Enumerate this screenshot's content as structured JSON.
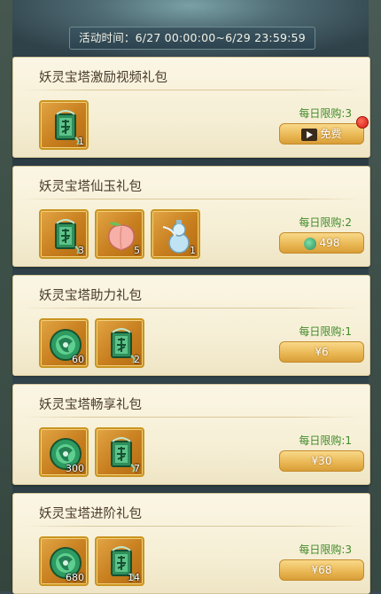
{
  "header": {
    "time_text": "活动时间：6/27 00:00:00~6/29 23:59:59"
  },
  "packs": [
    {
      "title": "妖灵宝塔激励视频礼包",
      "limit": "每日限购:3",
      "price": "免费",
      "price_icon": "video-icon",
      "has_red_dot": true,
      "items": [
        {
          "icon": "jade-token-icon",
          "count": "1"
        }
      ]
    },
    {
      "title": "妖灵宝塔仙玉礼包",
      "limit": "每日限购:2",
      "price": "498",
      "price_icon": "jade-coin-icon",
      "items": [
        {
          "icon": "jade-token-icon",
          "count": "3"
        },
        {
          "icon": "peach-icon",
          "count": "5"
        },
        {
          "icon": "gourd-icon",
          "count": "1"
        }
      ]
    },
    {
      "title": "妖灵宝塔助力礼包",
      "limit": "每日限购:1",
      "price": "¥6",
      "items": [
        {
          "icon": "jade-disc-icon",
          "count": "60"
        },
        {
          "icon": "jade-token-icon",
          "count": "2"
        }
      ]
    },
    {
      "title": "妖灵宝塔畅享礼包",
      "limit": "每日限购:1",
      "price": "¥30",
      "items": [
        {
          "icon": "jade-disc-icon",
          "count": "300"
        },
        {
          "icon": "jade-token-icon",
          "count": "7"
        }
      ]
    },
    {
      "title": "妖灵宝塔进阶礼包",
      "limit": "每日限购:3",
      "price": "¥68",
      "items": [
        {
          "icon": "jade-disc-icon",
          "count": "680"
        },
        {
          "icon": "jade-token-icon",
          "count": "14"
        }
      ]
    }
  ],
  "colors": {
    "limit_green": "#3f8a28",
    "button_gold": "#e9b652",
    "card_bg": "#f6efd6"
  }
}
